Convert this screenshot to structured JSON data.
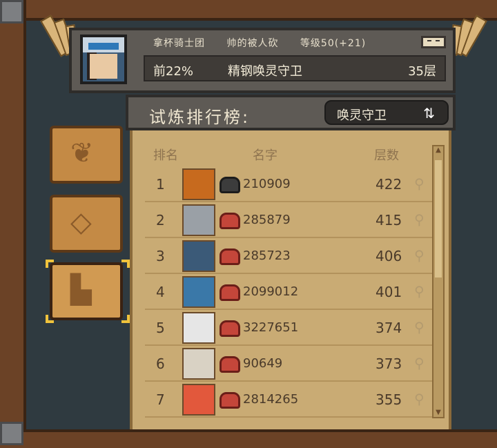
{
  "header": {
    "guild": "拿杯骑士团",
    "player_name": "帅的被人砍",
    "level": "等级50(+21)",
    "rank_percent": "前22%",
    "title": "精钢唤灵守卫",
    "floor": "35层"
  },
  "leaderboard": {
    "title": "试炼排行榜:",
    "mode_label": "唤灵守卫",
    "swap_icon": "swap-icon",
    "columns": [
      "排名",
      "名字",
      "层数"
    ],
    "rows": [
      {
        "rank": "1",
        "uid": "210909",
        "floors": "422",
        "badge": "dark"
      },
      {
        "rank": "2",
        "uid": "285879",
        "floors": "415",
        "badge": "red"
      },
      {
        "rank": "3",
        "uid": "285723",
        "floors": "406",
        "badge": "red"
      },
      {
        "rank": "4",
        "uid": "2099012",
        "floors": "401",
        "badge": "red"
      },
      {
        "rank": "5",
        "uid": "3227651",
        "floors": "374",
        "badge": "red"
      },
      {
        "rank": "6",
        "uid": "90649",
        "floors": "373",
        "badge": "red"
      },
      {
        "rank": "7",
        "uid": "2814265",
        "floors": "355",
        "badge": "red"
      }
    ]
  },
  "side_tabs": [
    {
      "icon": "leaf-icon",
      "glyph": "❦"
    },
    {
      "icon": "diamond-icon",
      "glyph": "◇"
    },
    {
      "icon": "podium-icon",
      "glyph": "▙",
      "selected": true
    }
  ],
  "colors": {
    "panel": "#c9ab74",
    "header": "#5e5a55",
    "selection": "#f0c33c",
    "badge_red": "#c4463a"
  }
}
